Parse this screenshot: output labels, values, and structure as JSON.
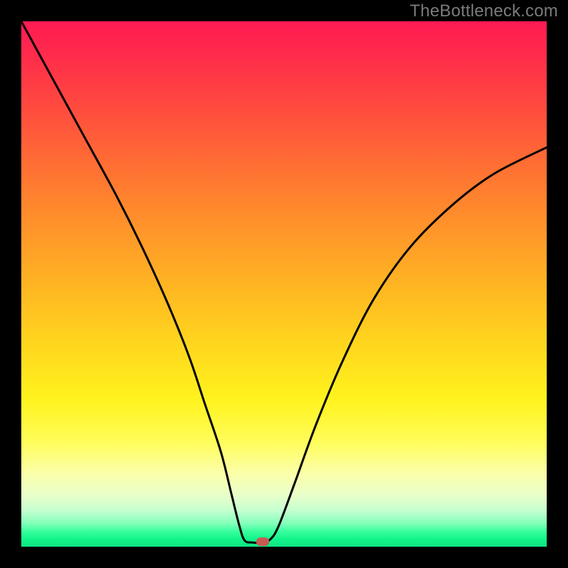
{
  "watermark": "TheBottleneck.com",
  "chart_data": {
    "type": "line",
    "title": "",
    "xlabel": "",
    "ylabel": "",
    "xlim": [
      0,
      100
    ],
    "ylim": [
      0,
      100
    ],
    "grid": false,
    "curve_points": [
      {
        "x": 0,
        "y": 100
      },
      {
        "x": 6,
        "y": 89
      },
      {
        "x": 12,
        "y": 78
      },
      {
        "x": 18,
        "y": 67
      },
      {
        "x": 23,
        "y": 57
      },
      {
        "x": 28,
        "y": 46
      },
      {
        "x": 32,
        "y": 36
      },
      {
        "x": 35,
        "y": 27
      },
      {
        "x": 38,
        "y": 18
      },
      {
        "x": 40,
        "y": 10
      },
      {
        "x": 41.5,
        "y": 4
      },
      {
        "x": 42.5,
        "y": 1.2
      },
      {
        "x": 44,
        "y": 0.8
      },
      {
        "x": 46,
        "y": 0.8
      },
      {
        "x": 47.5,
        "y": 1.5
      },
      {
        "x": 49,
        "y": 4
      },
      {
        "x": 52,
        "y": 12
      },
      {
        "x": 56,
        "y": 23
      },
      {
        "x": 61,
        "y": 35
      },
      {
        "x": 67,
        "y": 47
      },
      {
        "x": 74,
        "y": 57
      },
      {
        "x": 82,
        "y": 65
      },
      {
        "x": 90,
        "y": 71
      },
      {
        "x": 100,
        "y": 76
      }
    ],
    "marker": {
      "x": 46,
      "y": 1
    },
    "gradient_stops": [
      {
        "pct": 0,
        "color": "#ff1a53"
      },
      {
        "pct": 50,
        "color": "#ffb324"
      },
      {
        "pct": 80,
        "color": "#fffd5a"
      },
      {
        "pct": 100,
        "color": "#0ee483"
      }
    ]
  }
}
